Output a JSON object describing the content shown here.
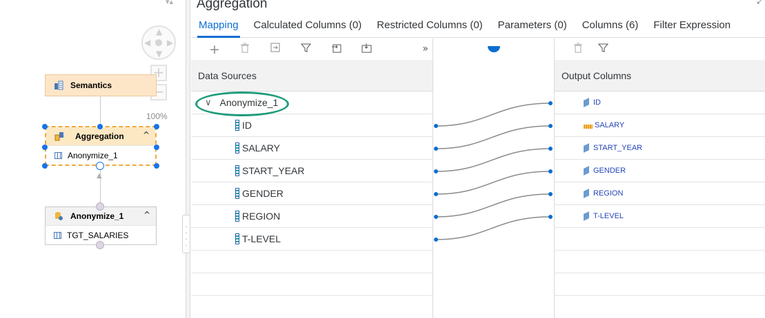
{
  "window": {
    "title": "Aggregation"
  },
  "tabs": [
    {
      "label": "Mapping"
    },
    {
      "label": "Calculated Columns (0)"
    },
    {
      "label": "Restricted Columns (0)"
    },
    {
      "label": "Parameters (0)"
    },
    {
      "label": "Columns (6)"
    },
    {
      "label": "Filter Expression"
    }
  ],
  "canvas": {
    "zoom": "100%",
    "nodes": {
      "semantics": {
        "title": "Semantics"
      },
      "aggregation": {
        "title": "Aggregation",
        "input": "Anonymize_1"
      },
      "anonymize": {
        "title": "Anonymize_1",
        "input": "TGT_SALARIES"
      }
    }
  },
  "data_sources": {
    "header": "Data Sources",
    "parent": "Anonymize_1",
    "columns": [
      "ID",
      "SALARY",
      "START_YEAR",
      "GENDER",
      "REGION",
      "T-LEVEL"
    ]
  },
  "output_columns": {
    "header": "Output Columns",
    "columns": [
      "ID",
      "SALARY",
      "START_YEAR",
      "GENDER",
      "REGION",
      "T-LEVEL"
    ]
  },
  "colors": {
    "accent": "#0a6ed1",
    "highlight_oval": "#1e9c7c",
    "link_line": "#8a8a8a"
  }
}
